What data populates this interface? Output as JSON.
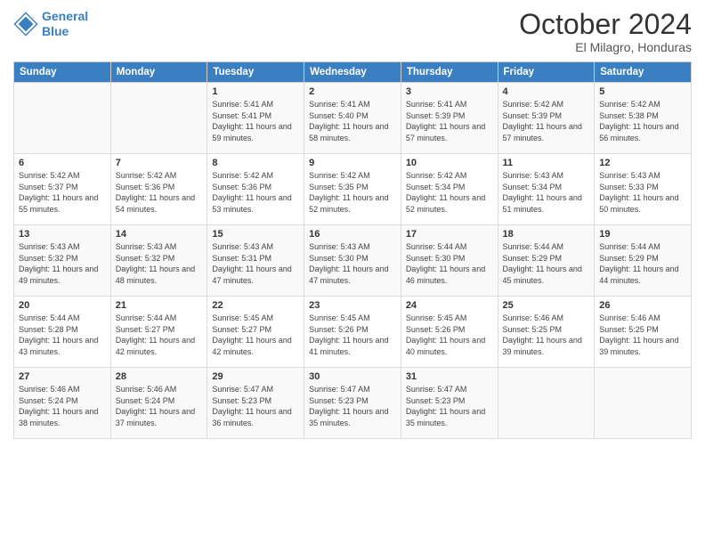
{
  "logo": {
    "line1": "General",
    "line2": "Blue"
  },
  "title": "October 2024",
  "location": "El Milagro, Honduras",
  "weekdays": [
    "Sunday",
    "Monday",
    "Tuesday",
    "Wednesday",
    "Thursday",
    "Friday",
    "Saturday"
  ],
  "weeks": [
    [
      {
        "day": "",
        "sunrise": "",
        "sunset": "",
        "daylight": ""
      },
      {
        "day": "",
        "sunrise": "",
        "sunset": "",
        "daylight": ""
      },
      {
        "day": "1",
        "sunrise": "Sunrise: 5:41 AM",
        "sunset": "Sunset: 5:41 PM",
        "daylight": "Daylight: 11 hours and 59 minutes."
      },
      {
        "day": "2",
        "sunrise": "Sunrise: 5:41 AM",
        "sunset": "Sunset: 5:40 PM",
        "daylight": "Daylight: 11 hours and 58 minutes."
      },
      {
        "day": "3",
        "sunrise": "Sunrise: 5:41 AM",
        "sunset": "Sunset: 5:39 PM",
        "daylight": "Daylight: 11 hours and 57 minutes."
      },
      {
        "day": "4",
        "sunrise": "Sunrise: 5:42 AM",
        "sunset": "Sunset: 5:39 PM",
        "daylight": "Daylight: 11 hours and 57 minutes."
      },
      {
        "day": "5",
        "sunrise": "Sunrise: 5:42 AM",
        "sunset": "Sunset: 5:38 PM",
        "daylight": "Daylight: 11 hours and 56 minutes."
      }
    ],
    [
      {
        "day": "6",
        "sunrise": "Sunrise: 5:42 AM",
        "sunset": "Sunset: 5:37 PM",
        "daylight": "Daylight: 11 hours and 55 minutes."
      },
      {
        "day": "7",
        "sunrise": "Sunrise: 5:42 AM",
        "sunset": "Sunset: 5:36 PM",
        "daylight": "Daylight: 11 hours and 54 minutes."
      },
      {
        "day": "8",
        "sunrise": "Sunrise: 5:42 AM",
        "sunset": "Sunset: 5:36 PM",
        "daylight": "Daylight: 11 hours and 53 minutes."
      },
      {
        "day": "9",
        "sunrise": "Sunrise: 5:42 AM",
        "sunset": "Sunset: 5:35 PM",
        "daylight": "Daylight: 11 hours and 52 minutes."
      },
      {
        "day": "10",
        "sunrise": "Sunrise: 5:42 AM",
        "sunset": "Sunset: 5:34 PM",
        "daylight": "Daylight: 11 hours and 52 minutes."
      },
      {
        "day": "11",
        "sunrise": "Sunrise: 5:43 AM",
        "sunset": "Sunset: 5:34 PM",
        "daylight": "Daylight: 11 hours and 51 minutes."
      },
      {
        "day": "12",
        "sunrise": "Sunrise: 5:43 AM",
        "sunset": "Sunset: 5:33 PM",
        "daylight": "Daylight: 11 hours and 50 minutes."
      }
    ],
    [
      {
        "day": "13",
        "sunrise": "Sunrise: 5:43 AM",
        "sunset": "Sunset: 5:32 PM",
        "daylight": "Daylight: 11 hours and 49 minutes."
      },
      {
        "day": "14",
        "sunrise": "Sunrise: 5:43 AM",
        "sunset": "Sunset: 5:32 PM",
        "daylight": "Daylight: 11 hours and 48 minutes."
      },
      {
        "day": "15",
        "sunrise": "Sunrise: 5:43 AM",
        "sunset": "Sunset: 5:31 PM",
        "daylight": "Daylight: 11 hours and 47 minutes."
      },
      {
        "day": "16",
        "sunrise": "Sunrise: 5:43 AM",
        "sunset": "Sunset: 5:30 PM",
        "daylight": "Daylight: 11 hours and 47 minutes."
      },
      {
        "day": "17",
        "sunrise": "Sunrise: 5:44 AM",
        "sunset": "Sunset: 5:30 PM",
        "daylight": "Daylight: 11 hours and 46 minutes."
      },
      {
        "day": "18",
        "sunrise": "Sunrise: 5:44 AM",
        "sunset": "Sunset: 5:29 PM",
        "daylight": "Daylight: 11 hours and 45 minutes."
      },
      {
        "day": "19",
        "sunrise": "Sunrise: 5:44 AM",
        "sunset": "Sunset: 5:29 PM",
        "daylight": "Daylight: 11 hours and 44 minutes."
      }
    ],
    [
      {
        "day": "20",
        "sunrise": "Sunrise: 5:44 AM",
        "sunset": "Sunset: 5:28 PM",
        "daylight": "Daylight: 11 hours and 43 minutes."
      },
      {
        "day": "21",
        "sunrise": "Sunrise: 5:44 AM",
        "sunset": "Sunset: 5:27 PM",
        "daylight": "Daylight: 11 hours and 42 minutes."
      },
      {
        "day": "22",
        "sunrise": "Sunrise: 5:45 AM",
        "sunset": "Sunset: 5:27 PM",
        "daylight": "Daylight: 11 hours and 42 minutes."
      },
      {
        "day": "23",
        "sunrise": "Sunrise: 5:45 AM",
        "sunset": "Sunset: 5:26 PM",
        "daylight": "Daylight: 11 hours and 41 minutes."
      },
      {
        "day": "24",
        "sunrise": "Sunrise: 5:45 AM",
        "sunset": "Sunset: 5:26 PM",
        "daylight": "Daylight: 11 hours and 40 minutes."
      },
      {
        "day": "25",
        "sunrise": "Sunrise: 5:46 AM",
        "sunset": "Sunset: 5:25 PM",
        "daylight": "Daylight: 11 hours and 39 minutes."
      },
      {
        "day": "26",
        "sunrise": "Sunrise: 5:46 AM",
        "sunset": "Sunset: 5:25 PM",
        "daylight": "Daylight: 11 hours and 39 minutes."
      }
    ],
    [
      {
        "day": "27",
        "sunrise": "Sunrise: 5:46 AM",
        "sunset": "Sunset: 5:24 PM",
        "daylight": "Daylight: 11 hours and 38 minutes."
      },
      {
        "day": "28",
        "sunrise": "Sunrise: 5:46 AM",
        "sunset": "Sunset: 5:24 PM",
        "daylight": "Daylight: 11 hours and 37 minutes."
      },
      {
        "day": "29",
        "sunrise": "Sunrise: 5:47 AM",
        "sunset": "Sunset: 5:23 PM",
        "daylight": "Daylight: 11 hours and 36 minutes."
      },
      {
        "day": "30",
        "sunrise": "Sunrise: 5:47 AM",
        "sunset": "Sunset: 5:23 PM",
        "daylight": "Daylight: 11 hours and 35 minutes."
      },
      {
        "day": "31",
        "sunrise": "Sunrise: 5:47 AM",
        "sunset": "Sunset: 5:23 PM",
        "daylight": "Daylight: 11 hours and 35 minutes."
      },
      {
        "day": "",
        "sunrise": "",
        "sunset": "",
        "daylight": ""
      },
      {
        "day": "",
        "sunrise": "",
        "sunset": "",
        "daylight": ""
      }
    ]
  ]
}
